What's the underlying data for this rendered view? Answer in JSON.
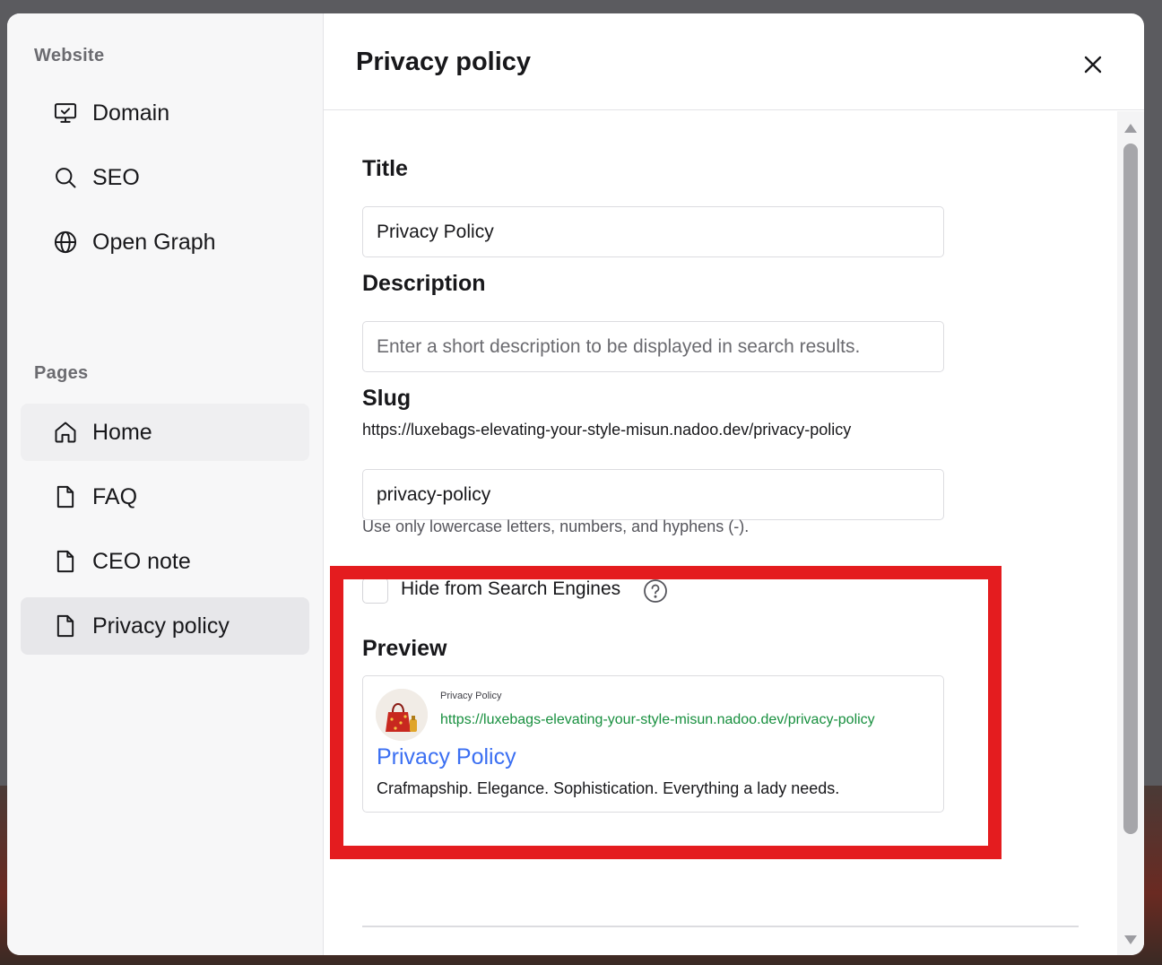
{
  "sidebar": {
    "website_label": "Website",
    "website_items": [
      {
        "label": "Domain",
        "icon": "monitor-icon"
      },
      {
        "label": "SEO",
        "icon": "search-icon"
      },
      {
        "label": "Open Graph",
        "icon": "globe-icon"
      }
    ],
    "pages_label": "Pages",
    "page_items": [
      {
        "label": "Home",
        "icon": "home-icon"
      },
      {
        "label": "FAQ",
        "icon": "file-icon"
      },
      {
        "label": "CEO note",
        "icon": "file-icon"
      },
      {
        "label": "Privacy policy",
        "icon": "file-icon",
        "active": true
      }
    ]
  },
  "header": {
    "title": "Privacy policy",
    "close_icon": "close-icon"
  },
  "form": {
    "title_label": "Title",
    "title_value": "Privacy Policy",
    "description_label": "Description",
    "description_value": "",
    "description_placeholder": "Enter a short description to be displayed in search results.",
    "slug_label": "Slug",
    "slug_url": "https://luxebags-elevating-your-style-misun.nadoo.dev/privacy-policy",
    "slug_value": "privacy-policy",
    "slug_hint": "Use only lowercase letters, numbers, and hyphens (-).",
    "hide_label": "Hide from Search Engines",
    "hide_checked": false
  },
  "preview": {
    "label": "Preview",
    "site_name": "Privacy Policy",
    "url": "https://luxebags-elevating-your-style-misun.nadoo.dev/privacy-policy",
    "title": "Privacy Policy",
    "description": "Crafmapship. Elegance. Sophistication. Everything a lady needs."
  },
  "colors": {
    "highlight": "#e41c1f",
    "link_blue": "#3b6ff2",
    "url_green": "#178f3e"
  }
}
